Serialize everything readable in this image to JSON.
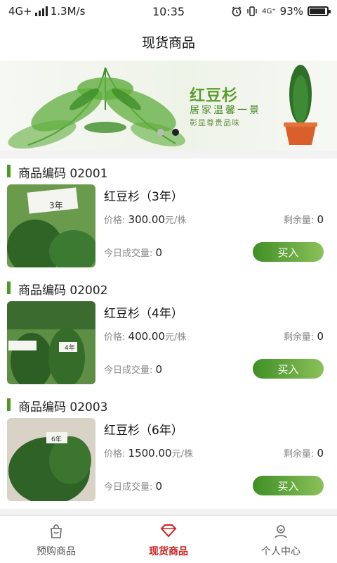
{
  "status_bar": {
    "network": "4G+",
    "speed": "1.3M/s",
    "time": "10:35",
    "network2": "4G⁺",
    "battery": "93%",
    "battery_level": 0.93
  },
  "header": {
    "title": "现货商品"
  },
  "banner": {
    "title": "红豆杉",
    "line1": "居家温馨一景",
    "line2": "彰显尊贵品味",
    "dots": 2,
    "active_dot": 1
  },
  "labels": {
    "code_prefix": "商品编码",
    "price": "价格:",
    "unit": "元/株",
    "stock": "剩余量:",
    "today": "今日成交量:",
    "buy": "买入"
  },
  "products": [
    {
      "code": "02001",
      "name": "红豆杉（3年）",
      "price": "300.00",
      "stock": "0",
      "today": "0",
      "tag": "3年"
    },
    {
      "code": "02002",
      "name": "红豆杉（4年）",
      "price": "400.00",
      "stock": "0",
      "today": "0",
      "tag": "4年"
    },
    {
      "code": "02003",
      "name": "红豆杉（6年）",
      "price": "1500.00",
      "stock": "0",
      "today": "0",
      "tag": "6年"
    }
  ],
  "tabbar": {
    "items": [
      {
        "label": "预购商品",
        "icon": "shopping-bag-icon",
        "active": false
      },
      {
        "label": "现货商品",
        "icon": "diamond-icon",
        "active": true
      },
      {
        "label": "个人中心",
        "icon": "user-icon",
        "active": false
      }
    ]
  },
  "colors": {
    "accent_green": "#4a9a25",
    "active_tab": "#d0201e",
    "button_gradient_start": "#3f8f25",
    "button_gradient_end": "#8cc05a"
  }
}
